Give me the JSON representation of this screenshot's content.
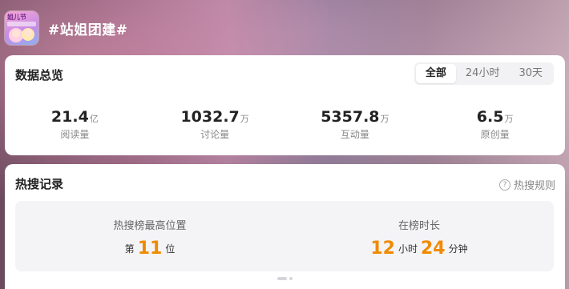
{
  "header": {
    "avatar_text": "姐儿节",
    "title": "#站姐团建#"
  },
  "overview": {
    "title": "数据总览",
    "tabs": [
      {
        "label": "全部",
        "active": true
      },
      {
        "label": "24小时",
        "active": false
      },
      {
        "label": "30天",
        "active": false
      }
    ],
    "stats": [
      {
        "value": "21.4",
        "unit": "亿",
        "label": "阅读量"
      },
      {
        "value": "1032.7",
        "unit": "万",
        "label": "讨论量"
      },
      {
        "value": "5357.8",
        "unit": "万",
        "label": "互动量"
      },
      {
        "value": "6.5",
        "unit": "万",
        "label": "原创量"
      }
    ]
  },
  "hot_search": {
    "title": "热搜记录",
    "rules_label": "热搜规则",
    "rules_icon": "question-circle-icon",
    "highest_position": {
      "label": "热搜榜最高位置",
      "prefix": "第",
      "value": "11",
      "suffix": "位"
    },
    "duration": {
      "label": "在榜时长",
      "hours": "12",
      "hours_unit": "小时",
      "minutes": "24",
      "minutes_unit": "分钟"
    }
  },
  "colors": {
    "accent_orange": "#f08a00",
    "card_bg": "#ffffff",
    "panel_bg": "#f4f4f6"
  }
}
